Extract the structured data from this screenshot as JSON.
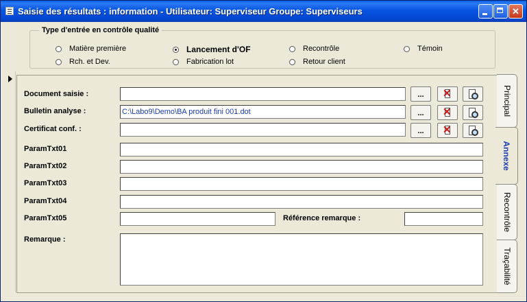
{
  "window": {
    "title": "Saisie des résultats : information - Utilisateur: Superviseur    Groupe: Superviseurs"
  },
  "qc_group": {
    "legend": "Type d'entrée en contrôle qualité",
    "options": [
      {
        "label": "Matière première",
        "selected": false
      },
      {
        "label": "Rch. et Dev.",
        "selected": false
      },
      {
        "label": "Lancement d'OF",
        "selected": true
      },
      {
        "label": "Fabrication lot",
        "selected": false
      },
      {
        "label": "Recontrôle",
        "selected": false
      },
      {
        "label": "Retour client",
        "selected": false
      },
      {
        "label": "Témoin",
        "selected": false
      }
    ]
  },
  "fields": {
    "document_saisie": {
      "label": "Document saisie :",
      "value": ""
    },
    "bulletin_analyse": {
      "label": "Bulletin analyse :",
      "value": "C:\\Labo9\\Demo\\BA produit fini 001.dot"
    },
    "certificat_conf": {
      "label": "Certificat conf. :",
      "value": ""
    },
    "param1": {
      "label": "ParamTxt01",
      "value": ""
    },
    "param2": {
      "label": "ParamTxt02",
      "value": ""
    },
    "param3": {
      "label": "ParamTxt03",
      "value": ""
    },
    "param4": {
      "label": "ParamTxt04",
      "value": ""
    },
    "param5": {
      "label": "ParamTxt05",
      "value": ""
    },
    "reference_remarque": {
      "label": "Référence remarque :",
      "value": ""
    },
    "remarque": {
      "label": "Remarque :",
      "value": ""
    }
  },
  "browse_button_label": "...",
  "tabs": [
    {
      "label": "Principal",
      "active": false
    },
    {
      "label": "Annexe",
      "active": true
    },
    {
      "label": "Recontrôle",
      "active": false
    },
    {
      "label": "Traçabilité",
      "active": false
    }
  ]
}
